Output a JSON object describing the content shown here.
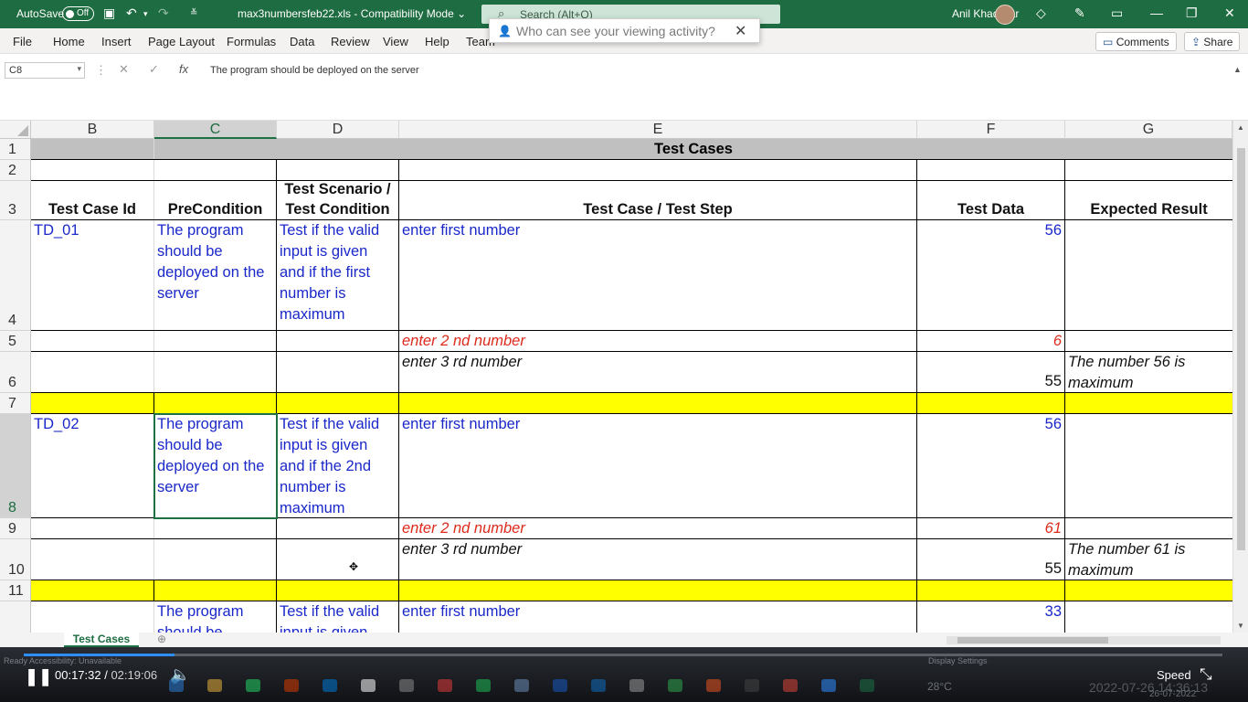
{
  "titlebar": {
    "autosave_label": "AutoSave",
    "autosave_state": "Off",
    "filename": "max3numbersfeb22.xls",
    "mode": "Compatibility Mode",
    "search_placeholder": "Search (Alt+Q)",
    "user_name": "Anil Khadilkar"
  },
  "ribbon": {
    "tabs": [
      "File",
      "Home",
      "Insert",
      "Page Layout",
      "Formulas",
      "Data",
      "Review",
      "View",
      "Help",
      "Team"
    ],
    "comments_label": "Comments",
    "share_label": "Share"
  },
  "popup": {
    "text": "Who can see your viewing activity?"
  },
  "formula_bar": {
    "name_box": "C8",
    "content": "The program should be deployed on the server"
  },
  "columns": [
    "B",
    "C",
    "D",
    "E",
    "F",
    "G"
  ],
  "selected_column": "C",
  "row_numbers": [
    "1",
    "2",
    "3",
    "4",
    "5",
    "6",
    "7",
    "8",
    "9",
    "10",
    "11"
  ],
  "selected_row": "8",
  "sheet": {
    "title": "Test Cases",
    "headers": {
      "b": "Test Case Id",
      "c": "PreCondition",
      "d_line1": "Test Scenario /",
      "d_line2": "Test Condition",
      "e": "Test Case / Test Step",
      "f": "Test Data",
      "g": "Expected Result"
    },
    "tc1": {
      "id": "TD_01",
      "precondition": [
        "The program",
        "should be",
        "deployed on the",
        "server"
      ],
      "scenario": [
        "Test if the valid",
        "input is given",
        "and if the first",
        "number is",
        "maximum"
      ],
      "step1": "enter first number",
      "data1": "56",
      "step2": "enter 2 nd number",
      "data2": "6",
      "step3": "enter 3 rd number",
      "data3": "55",
      "expected": [
        "The number 56 is",
        "maximum"
      ]
    },
    "tc2": {
      "id": "TD_02",
      "precondition": [
        "The program",
        "should be",
        "deployed on the",
        "server"
      ],
      "scenario": [
        "Test if the valid",
        "input is given",
        "and if the 2nd",
        "number is",
        "maximum"
      ],
      "step1": "enter first number",
      "data1": "56",
      "step2": "enter 2 nd number",
      "data2": "61",
      "step3": "enter 3 rd number",
      "data3": "55",
      "expected": [
        "The number 61 is",
        "maximum"
      ]
    },
    "tc3": {
      "precondition": [
        "The program",
        "should be"
      ],
      "scenario": [
        "Test if the valid",
        "input is given"
      ],
      "step1": "enter first number",
      "data1": "33"
    }
  },
  "sheet_tab": "Test Cases",
  "status_bar": {
    "left": "Ready   Accessibility: Unavailable",
    "display_settings": "Display Settings"
  },
  "video": {
    "current_time": "00:17:32",
    "total_time": "02:19:06",
    "progress": 0.126,
    "speed_label": "Speed"
  },
  "taskbar": {
    "temperature": "28°C",
    "clock": "2022-07-26 14:36:13",
    "date": "26-07-2022"
  },
  "colors": {
    "excel_green": "#1e6c41",
    "header_gray": "#c0c0c0",
    "highlight_yellow": "#ffff00",
    "blue_text": "#1a28c9",
    "red_text": "#dc2a1c"
  }
}
